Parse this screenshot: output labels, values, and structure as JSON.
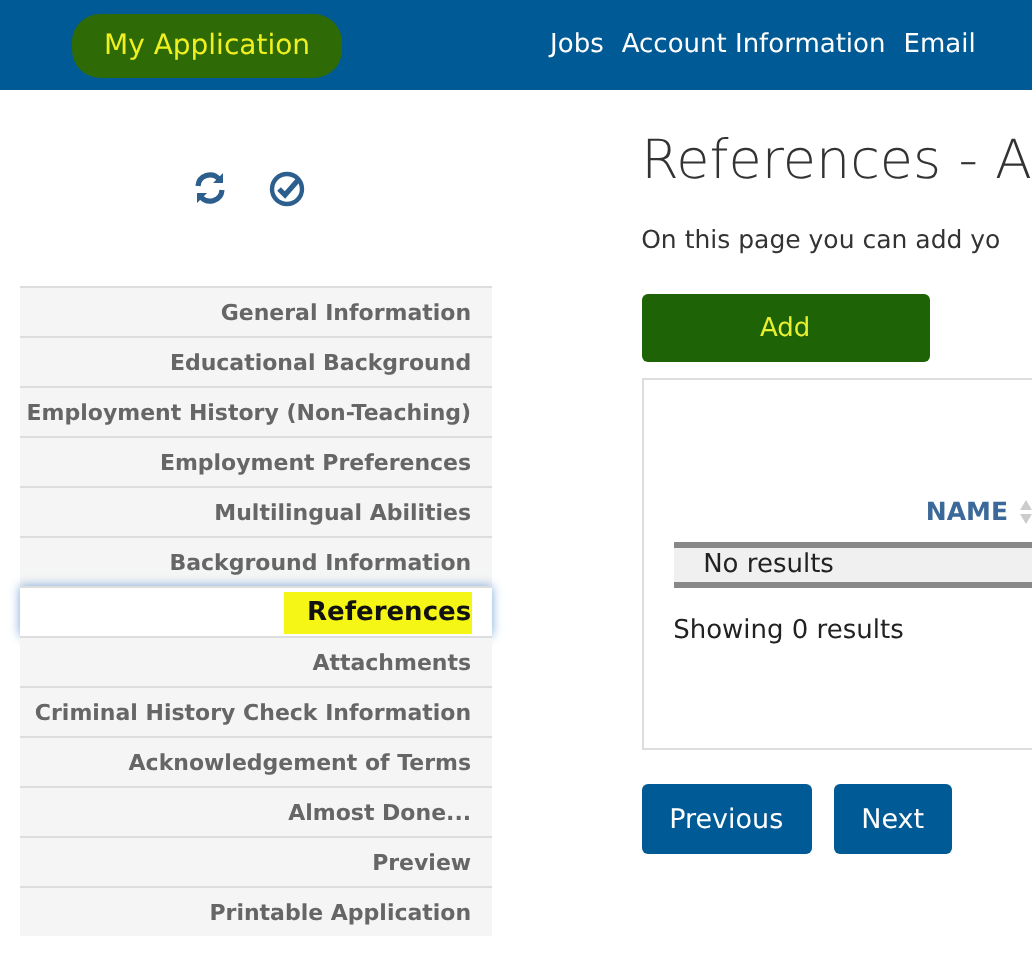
{
  "header": {
    "brand": "My Application",
    "brand_highlighted": true,
    "nav": [
      "Jobs",
      "Account Information",
      "Email"
    ]
  },
  "sidebar": {
    "items": [
      {
        "label": "General Information",
        "selected": false
      },
      {
        "label": "Educational Background",
        "selected": false
      },
      {
        "label": "Employment History (Non-Teaching)",
        "selected": false
      },
      {
        "label": "Employment Preferences",
        "selected": false
      },
      {
        "label": "Multilingual Abilities",
        "selected": false
      },
      {
        "label": "Background Information",
        "selected": false
      },
      {
        "label": "References",
        "selected": true
      },
      {
        "label": "Attachments",
        "selected": false
      },
      {
        "label": "Criminal History Check Information",
        "selected": false
      },
      {
        "label": "Acknowledgement of Terms",
        "selected": false
      },
      {
        "label": "Almost Done...",
        "selected": false
      },
      {
        "label": "Preview",
        "selected": false
      },
      {
        "label": "Printable Application",
        "selected": false
      }
    ]
  },
  "main": {
    "title": "References - A",
    "intro": "On this page you can add yo",
    "add_button": {
      "label": "Add",
      "highlighted": true
    },
    "table": {
      "columns": [
        "NAME"
      ],
      "empty_text": "No results",
      "summary": "Showing 0 results"
    },
    "buttons": [
      "Previous",
      "Next"
    ]
  }
}
